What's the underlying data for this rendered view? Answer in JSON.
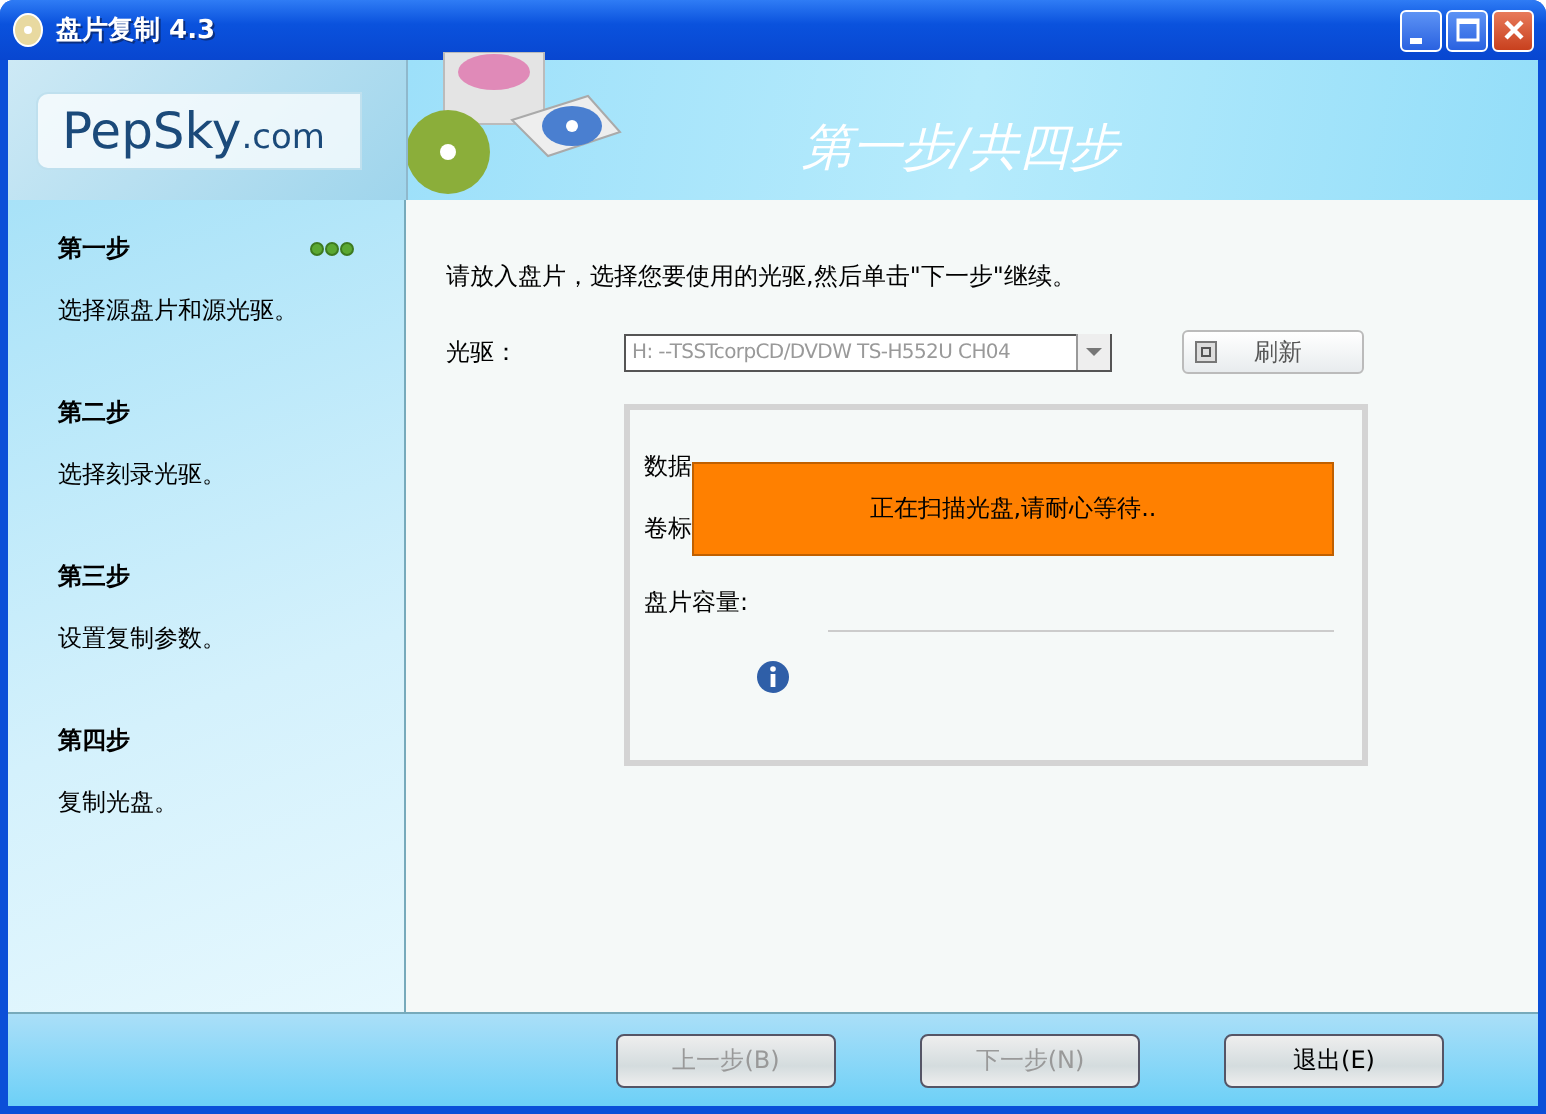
{
  "window": {
    "title": "盘片复制 4.3"
  },
  "logo": {
    "brand": "PepSky",
    "suffix": ".com"
  },
  "header": {
    "title": "第一步/共四步"
  },
  "steps": [
    {
      "title": "第一步",
      "description": "选择源盘片和源光驱。",
      "selected": true
    },
    {
      "title": "第二步",
      "description": "选择刻录光驱。",
      "selected": false
    },
    {
      "title": "第三步",
      "description": "设置复制参数。",
      "selected": false
    },
    {
      "title": "第四步",
      "description": "复制光盘。",
      "selected": false
    }
  ],
  "instruction": "请放入盘片，选择您要使用的光驱,然后单击\"下一步\"继续。",
  "drive": {
    "label": "光驱：",
    "value": "H:  --TSSTcorpCD/DVDW TS-H552U CH04",
    "disabled": true
  },
  "refresh_button": "刷新",
  "disc_info": {
    "labels": [
      "数据",
      "卷标",
      "盘片容量:"
    ]
  },
  "scan_message": "正在扫描光盘,请耐心等待..",
  "buttons": [
    {
      "label": "上一步(B)",
      "disabled": true
    },
    {
      "label": "下一步(N)",
      "disabled": true
    },
    {
      "label": "退出(E)",
      "disabled": false
    }
  ]
}
